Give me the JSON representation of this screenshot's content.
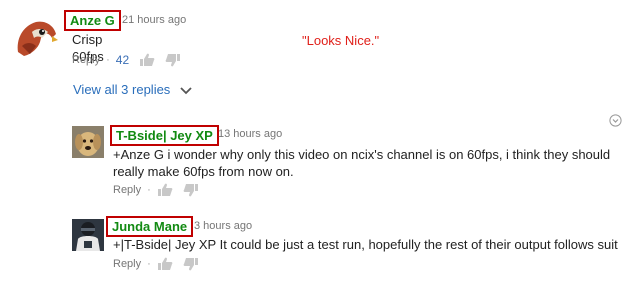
{
  "annotation": "\"Looks Nice.\"",
  "comments": [
    {
      "author": "Anze G",
      "time": "21 hours ago",
      "text": "Crisp 60fps",
      "reply": "Reply",
      "likes": "42"
    },
    {
      "author": "T-Bside| Jey XP",
      "time": "13 hours ago",
      "text": "+Anze G i wonder why only this video on ncix's channel is on 60fps, i think they should really make 60fps from now on.",
      "reply": "Reply"
    },
    {
      "author": "Junda Mane",
      "time": "3 hours ago",
      "text": "+|T-Bside| Jey XP It could be just a test run, hopefully the rest of their output follows suit",
      "reply": "Reply"
    }
  ],
  "view_replies": "View all 3 replies",
  "icons": {
    "like": "thumbs-up-icon",
    "dislike": "thumbs-down-icon",
    "expand": "chevron-down-icon",
    "menu": "circle-chevron-icon"
  },
  "colors": {
    "author": "#128a12",
    "highlight_box": "#c00000",
    "link": "#2a6ebb",
    "annotation": "#e0201a"
  }
}
